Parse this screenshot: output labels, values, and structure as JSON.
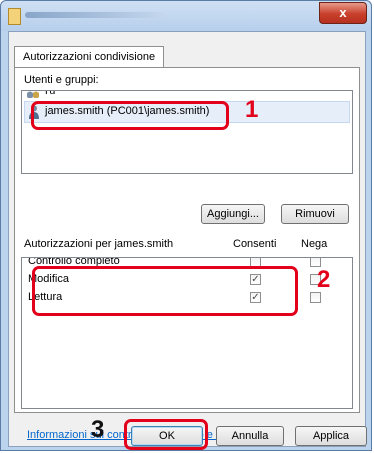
{
  "window": {
    "close_glyph": "x"
  },
  "tab": {
    "label": "Autorizzazioni condivisione"
  },
  "users": {
    "label": "Utenti e gruppi:",
    "partial_item": "Tu",
    "selected_item": "james.smith (PC001\\james.smith)"
  },
  "buttons": {
    "add": "Aggiungi...",
    "remove": "Rimuovi",
    "ok": "OK",
    "cancel": "Annulla",
    "apply": "Applica"
  },
  "permissions": {
    "label": "Autorizzazioni per james.smith",
    "col_allow": "Consenti",
    "col_deny": "Nega",
    "rows": [
      {
        "name": "Controllo completo",
        "allow": false,
        "deny": false
      },
      {
        "name": "Modifica",
        "allow": true,
        "deny": false
      },
      {
        "name": "Lettura",
        "allow": true,
        "deny": false
      }
    ]
  },
  "link": {
    "text": "Informazioni sui controllo di accesso e autorizzazioni"
  },
  "callouts": [
    "1",
    "2",
    "3"
  ],
  "colors": {
    "callout": "#e2001a",
    "link": "#0066cc"
  },
  "icons": [
    "user-icon",
    "group-icon",
    "close-icon",
    "window-icon"
  ]
}
